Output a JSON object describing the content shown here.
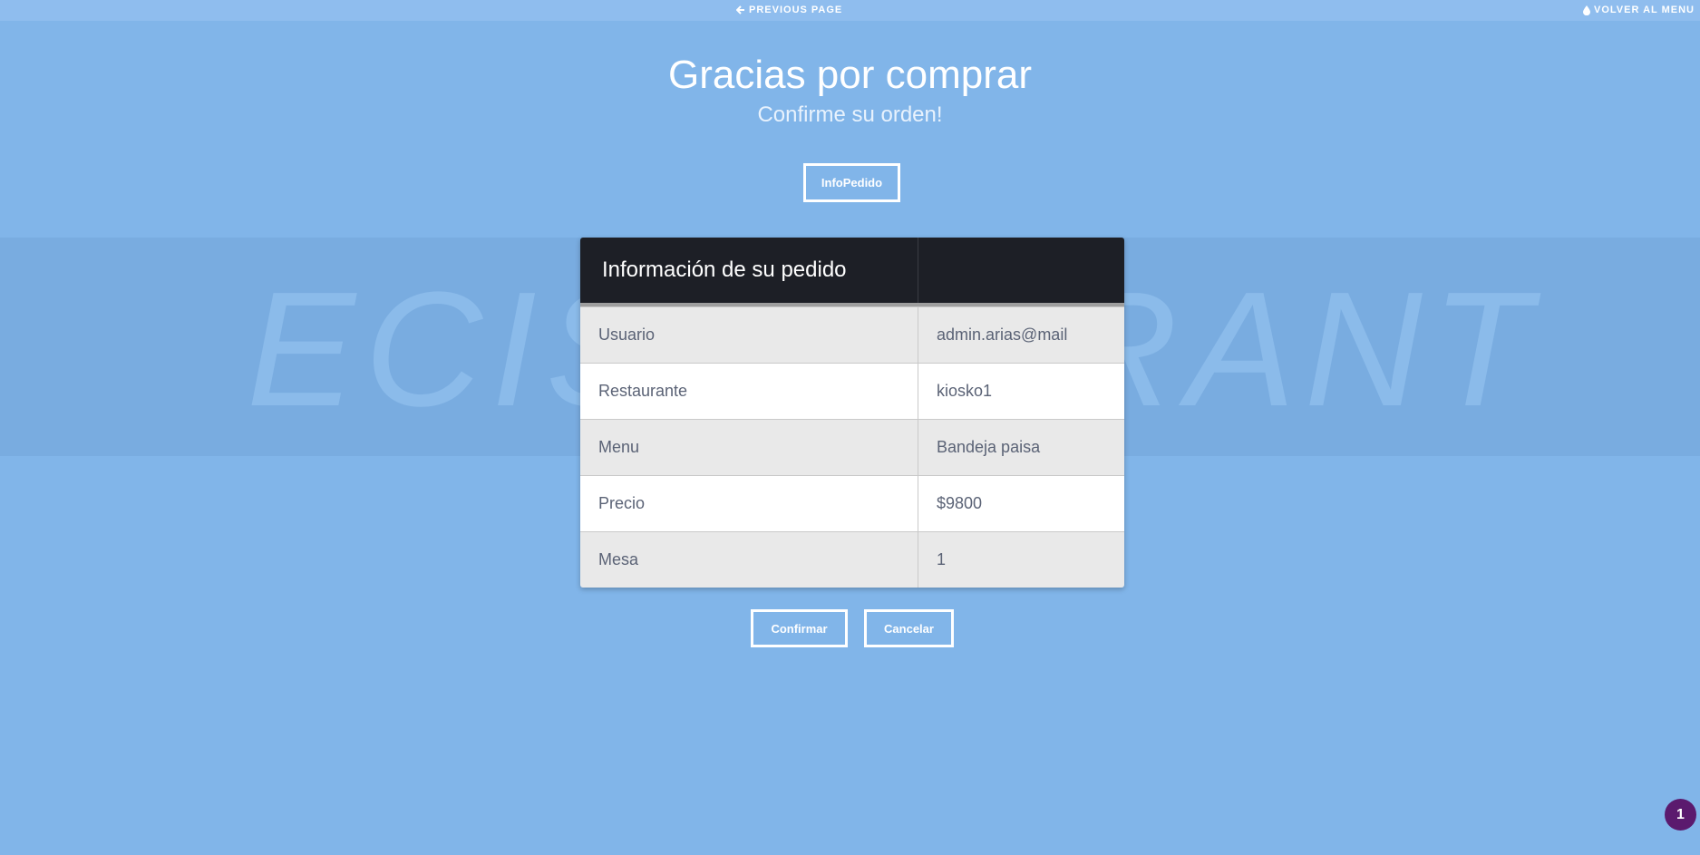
{
  "topbar": {
    "previous_label": "PREVIOUS PAGE",
    "menu_label": "VOLVER AL MENU",
    "previous_icon": "arrow-left-icon",
    "menu_icon": "drop-icon"
  },
  "header": {
    "title": "Gracias por comprar",
    "subtitle": "Confirme su orden!",
    "info_button": "InfoPedido"
  },
  "watermark": "ECIS TAURANT",
  "order_card": {
    "heading": "Información de su pedido",
    "rows": [
      {
        "label": "Usuario",
        "value": "admin.arias@mail"
      },
      {
        "label": "Restaurante",
        "value": "kiosko1"
      },
      {
        "label": "Menu",
        "value": "Bandeja paisa"
      },
      {
        "label": "Precio",
        "value": "$9800"
      },
      {
        "label": "Mesa",
        "value": "1"
      }
    ]
  },
  "actions": {
    "confirm_label": "Confirmar",
    "cancel_label": "Cancelar"
  },
  "badge": {
    "count": "1",
    "color": "#5b1a6e"
  },
  "colors": {
    "background": "#81b5e9",
    "card_header": "#1d1f26"
  }
}
